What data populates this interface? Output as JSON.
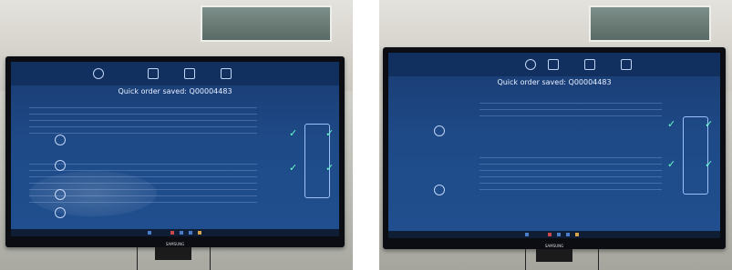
{
  "photos": [
    {
      "screen_title": "Quick order saved: Q00004483",
      "monitor_brand": "SAMSUNG",
      "icons": [
        "gear-icon",
        "tyre-icon",
        "car-icon",
        "check-icon"
      ]
    },
    {
      "screen_title": "Quick order saved: Q00004483",
      "monitor_brand": "SAMSUNG",
      "icons": [
        "gear-icon",
        "tyre-icon",
        "car-icon",
        "check-icon"
      ]
    }
  ],
  "colors": {
    "screen_blue": "#1e4a87",
    "check_green": "#66ffcc"
  }
}
